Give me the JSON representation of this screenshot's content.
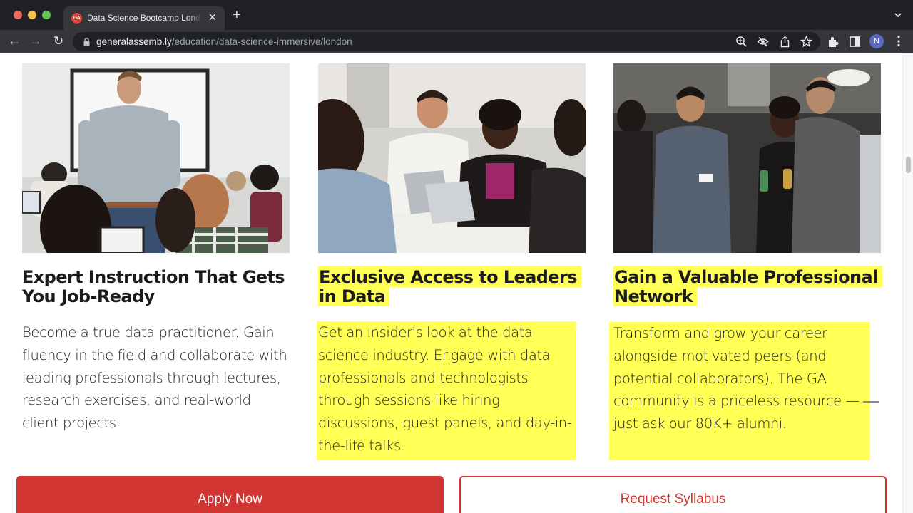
{
  "browser": {
    "tab": {
      "favicon_text": "GA",
      "title": "Data Science Bootcamp London | General Assembly",
      "close_glyph": "✕"
    },
    "new_tab_glyph": "+",
    "nav": {
      "back_glyph": "←",
      "forward_glyph": "→",
      "reload_glyph": "↻"
    },
    "url": {
      "host": "generalassemb.ly",
      "path": "/education/data-science-immersive/london"
    },
    "omnibox_icons": [
      "zoom-icon",
      "tracking-protection-icon",
      "share-icon",
      "bookmark-star-icon"
    ],
    "toolbar_icons": [
      "extensions-icon",
      "side-panel-icon"
    ],
    "profile_initial": "N"
  },
  "cards": [
    {
      "image_alt": "Instructor standing in a classroom with students on laptops",
      "heading": "Expert Instruction That Gets You Job-Ready",
      "heading_highlighted": false,
      "body": "Become a true data practitioner. Gain fluency in the field and collaborate with leading professionals through lectures, research exercises, and real-world client projects.",
      "body_highlighted": false
    },
    {
      "image_alt": "Students discussing around a table with laptops",
      "heading_lines": [
        "Exclusive Access to Leaders",
        "in Data"
      ],
      "heading_highlighted": true,
      "body": "Get an insider's look at the data science industry. Engage with data professionals and technologists through sessions like hiring discussions, guest panels, and day-in-the-life talks.",
      "body_highlighted": true
    },
    {
      "image_alt": "People networking at an event holding drinks",
      "heading_lines": [
        "Gain a Valuable Professional",
        "Network"
      ],
      "heading_highlighted": true,
      "body": "Transform and grow your career alongside motivated peers (and potential collaborators). The GA community is a priceless resource — just ask our 80K+ alumni.",
      "body_highlighted": true
    }
  ],
  "cta": {
    "apply_label": "Apply Now",
    "syllabus_label": "Request Syllabus"
  },
  "colors": {
    "highlight": "#ffff55",
    "brand_red": "#d03531"
  }
}
